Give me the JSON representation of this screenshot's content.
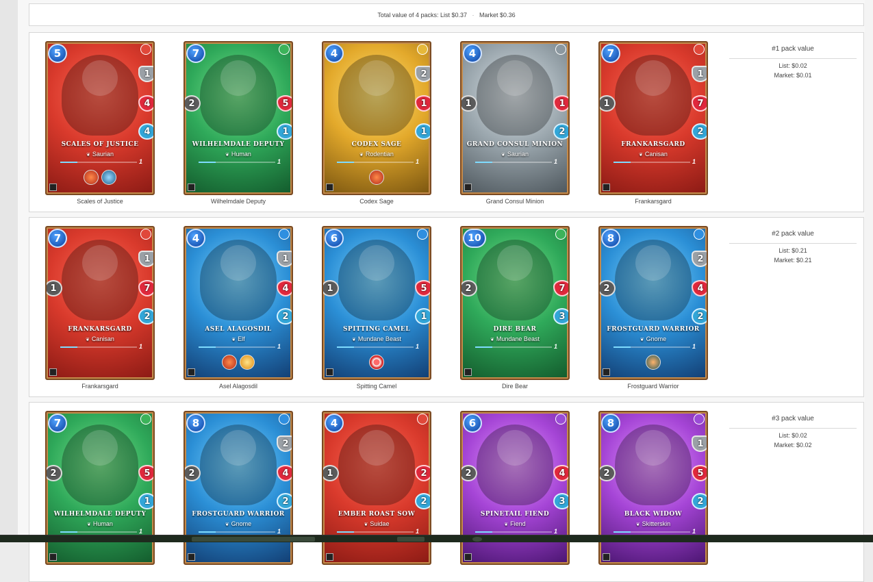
{
  "summary": {
    "prefix": "Total value of 4 packs: List $0.37",
    "separator": "·",
    "market": "Market $0.36"
  },
  "packs": [
    {
      "value_title": "#1 pack value",
      "list": "List: $0.02",
      "market": "Market: $0.01",
      "cards": [
        {
          "name": "SCALES OF JUSTICE",
          "race": "Saurian",
          "mana": "5",
          "level": "1",
          "element": "fire",
          "theme": "red",
          "armor": "1",
          "health": "4",
          "speed": "4",
          "attack": "",
          "abilities": [
            "fire",
            "water"
          ],
          "caption": "Scales of Justice"
        },
        {
          "name": "WILHELMDALE DEPUTY",
          "race": "Human",
          "mana": "7",
          "level": "1",
          "element": "earth",
          "theme": "green",
          "armor": "",
          "health": "5",
          "speed": "1",
          "attack": "2",
          "abilities": [],
          "caption": "Wilhelmdale Deputy"
        },
        {
          "name": "CODEX SAGE",
          "race": "Rodentian",
          "mana": "4",
          "level": "1",
          "element": "life",
          "theme": "gold",
          "armor": "2",
          "health": "1",
          "speed": "1",
          "attack": "",
          "abilities": [
            "fire"
          ],
          "caption": "Codex Sage"
        },
        {
          "name": "GRAND CONSUL MINION",
          "race": "Saurian",
          "mana": "4",
          "level": "1",
          "element": "neutral",
          "theme": "neutral",
          "armor": "",
          "health": "1",
          "speed": "2",
          "attack": "1",
          "abilities": [],
          "caption": "Grand Consul Minion"
        },
        {
          "name": "FRANKARSGARD",
          "race": "Canisan",
          "mana": "7",
          "level": "1",
          "element": "fire",
          "theme": "red",
          "armor": "1",
          "health": "7",
          "speed": "2",
          "attack": "1",
          "abilities": [],
          "caption": "Frankarsgard"
        }
      ]
    },
    {
      "value_title": "#2 pack value",
      "list": "List: $0.21",
      "market": "Market: $0.21",
      "cards": [
        {
          "name": "FRANKARSGARD",
          "race": "Canisan",
          "mana": "7",
          "level": "1",
          "element": "fire",
          "theme": "red",
          "armor": "1",
          "health": "7",
          "speed": "2",
          "attack": "1",
          "abilities": [],
          "caption": "Frankarsgard"
        },
        {
          "name": "ASEL ALAGOSDIL",
          "race": "Elf",
          "mana": "4",
          "level": "1",
          "element": "water",
          "theme": "blue",
          "armor": "1",
          "health": "4",
          "speed": "2",
          "attack": "",
          "abilities": [
            "fire",
            "sun"
          ],
          "caption": "Asel Alagosdil"
        },
        {
          "name": "SPITTING CAMEL",
          "race": "Mundane Beast",
          "mana": "6",
          "level": "1",
          "element": "water",
          "theme": "blue",
          "armor": "",
          "health": "5",
          "speed": "1",
          "attack": "1",
          "abilities": [
            "target"
          ],
          "caption": "Spitting Camel"
        },
        {
          "name": "DIRE BEAR",
          "race": "Mundane Beast",
          "mana": "10",
          "level": "1",
          "element": "earth",
          "theme": "green",
          "armor": "",
          "health": "7",
          "speed": "3",
          "attack": "2",
          "abilities": [],
          "caption": "Dire Bear"
        },
        {
          "name": "FROSTGUARD WARRIOR",
          "race": "Gnome",
          "mana": "8",
          "level": "1",
          "element": "water",
          "theme": "blue",
          "armor": "2",
          "health": "4",
          "speed": "2",
          "attack": "2",
          "abilities": [
            "sneak"
          ],
          "caption": "Frostguard Warrior"
        }
      ]
    },
    {
      "value_title": "#3 pack value",
      "list": "List: $0.02",
      "market": "Market: $0.02",
      "cards": [
        {
          "name": "WILHELMDALE DEPUTY",
          "race": "Human",
          "mana": "7",
          "level": "1",
          "element": "earth",
          "theme": "green",
          "armor": "",
          "health": "5",
          "speed": "1",
          "attack": "2",
          "abilities": [],
          "caption": ""
        },
        {
          "name": "FROSTGUARD WARRIOR",
          "race": "Gnome",
          "mana": "8",
          "level": "1",
          "element": "water",
          "theme": "blue",
          "armor": "2",
          "health": "4",
          "speed": "2",
          "attack": "2",
          "abilities": [],
          "caption": ""
        },
        {
          "name": "EMBER ROAST SOW",
          "race": "Suidae",
          "mana": "4",
          "level": "1",
          "element": "fire",
          "theme": "red",
          "armor": "",
          "health": "2",
          "speed": "2",
          "attack": "1",
          "abilities": [],
          "caption": ""
        },
        {
          "name": "SPINETAIL FIEND",
          "race": "Fiend",
          "mana": "6",
          "level": "1",
          "element": "death",
          "theme": "purple",
          "armor": "",
          "health": "4",
          "speed": "3",
          "attack": "2",
          "abilities": [],
          "caption": ""
        },
        {
          "name": "BLACK WIDOW",
          "race": "Skitterskin",
          "mana": "8",
          "level": "1",
          "element": "death",
          "theme": "purple",
          "armor": "1",
          "health": "5",
          "speed": "2",
          "attack": "2",
          "abilities": [],
          "caption": ""
        }
      ]
    }
  ]
}
